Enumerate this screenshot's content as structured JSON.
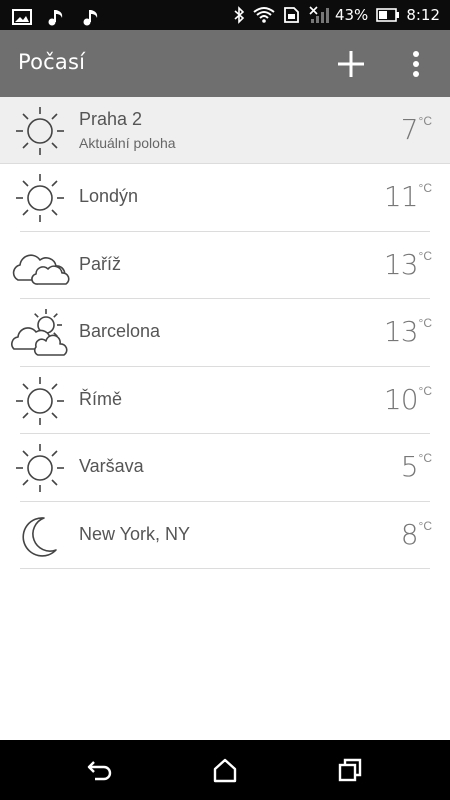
{
  "status_bar": {
    "battery_percent": "43%",
    "time": "8:12",
    "icons": [
      "image-icon",
      "music-note-icon",
      "music-note-icon",
      "bluetooth-icon",
      "wifi-icon",
      "sim-card-icon",
      "signal-off-icon",
      "battery-icon"
    ]
  },
  "app_bar": {
    "title": "Počasí",
    "actions": [
      "add-icon",
      "more-vert-icon"
    ]
  },
  "locations": [
    {
      "name": "Praha 2",
      "subtitle": "Aktuální poloha",
      "temp": "7",
      "unit": "°C",
      "icon": "sun-icon",
      "current": true
    },
    {
      "name": "Londýn",
      "temp": "11",
      "unit": "°C",
      "icon": "sun-icon"
    },
    {
      "name": "Paříž",
      "temp": "13",
      "unit": "°C",
      "icon": "cloud-icon"
    },
    {
      "name": "Barcelona",
      "temp": "13",
      "unit": "°C",
      "icon": "partly-cloudy-icon"
    },
    {
      "name": "Římě",
      "temp": "10",
      "unit": "°C",
      "icon": "sun-icon"
    },
    {
      "name": "Varšava",
      "temp": "5",
      "unit": "°C",
      "icon": "sun-icon"
    },
    {
      "name": "New York, NY",
      "temp": "8",
      "unit": "°C",
      "icon": "moon-icon"
    }
  ],
  "nav_bar": {
    "buttons": [
      "back-icon",
      "home-icon",
      "recent-apps-icon"
    ]
  },
  "colors": {
    "app_bar": "#6f6f6f",
    "status_bar": "#0c0c0c",
    "current_row": "#efefef",
    "text": "#555555"
  }
}
